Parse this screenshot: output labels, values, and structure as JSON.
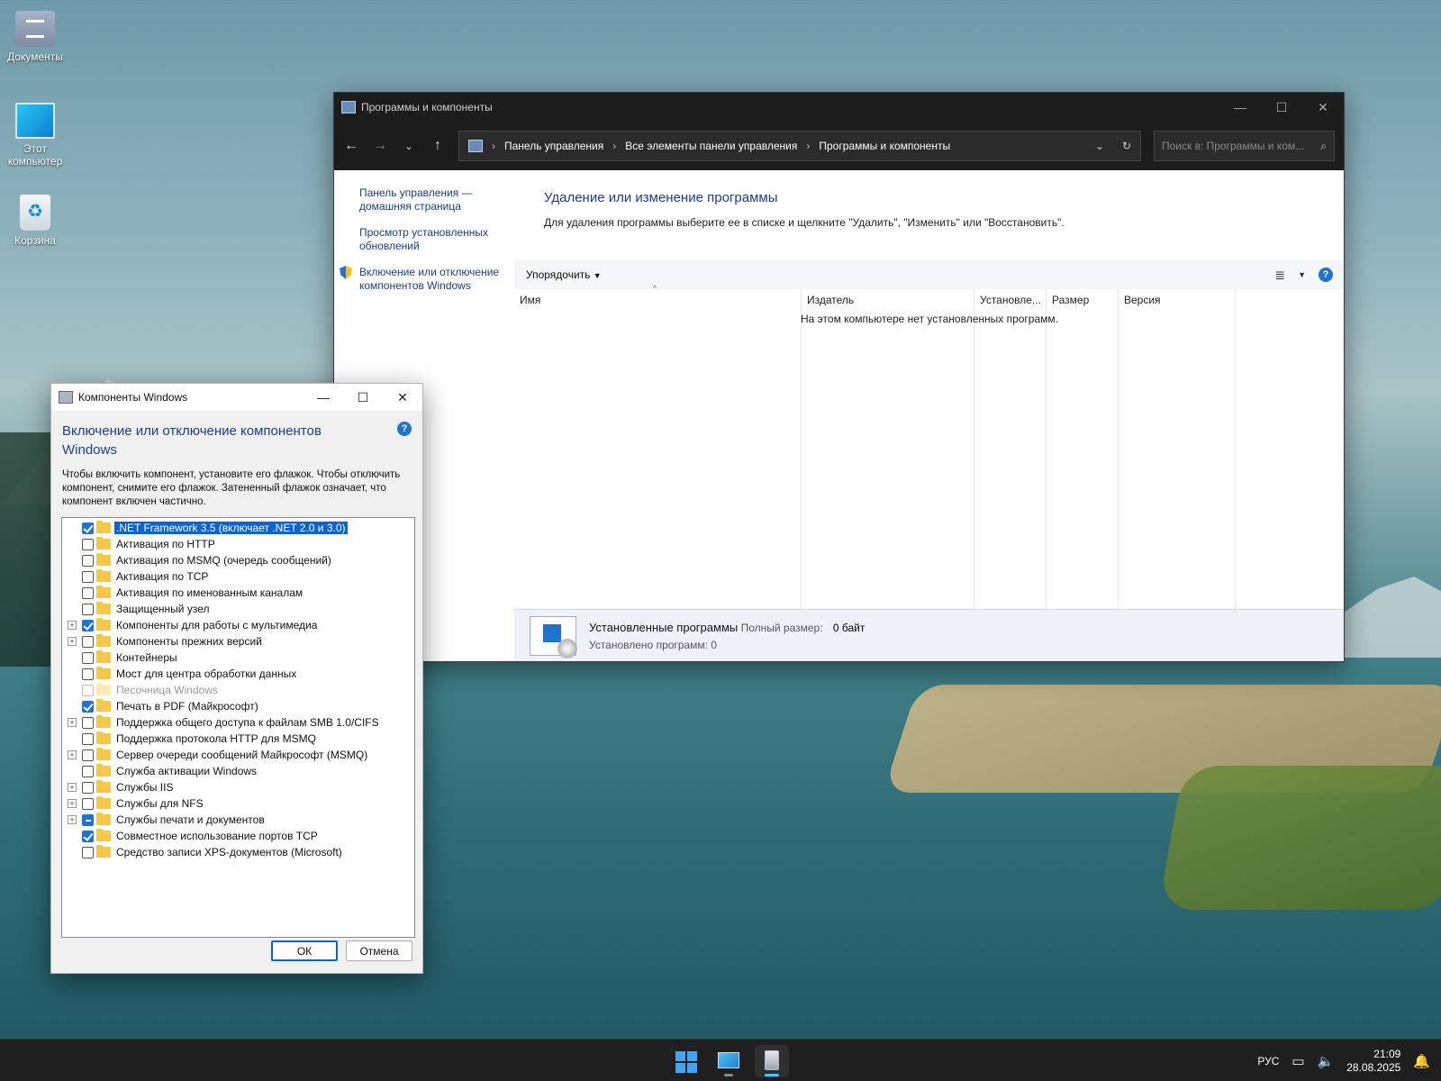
{
  "desktop": {
    "icons": [
      {
        "label": "Документы",
        "icon": "documents-folder-icon"
      },
      {
        "label": "Этот компьютер",
        "icon": "this-pc-icon"
      },
      {
        "label": "Корзина",
        "icon": "recycle-bin-icon"
      }
    ]
  },
  "programs_window": {
    "title": "Программы и компоненты",
    "breadcrumb": [
      "Панель управления",
      "Все элементы панели управления",
      "Программы и компоненты"
    ],
    "search_placeholder": "Поиск в: Программы и ком...",
    "sidebar_links": [
      "Панель управления — домашняя страница",
      "Просмотр установленных обновлений",
      "Включение или отключение компонентов Windows"
    ],
    "heading": "Удаление или изменение программы",
    "description": "Для удаления программы выберите ее в списке и щелкните \"Удалить\", \"Изменить\" или \"Восстановить\".",
    "organize_label": "Упорядочить",
    "columns": [
      "Имя",
      "Издатель",
      "Установле...",
      "Размер",
      "Версия"
    ],
    "empty_message": "На этом компьютере нет установленных программ.",
    "details": {
      "title": "Установленные программы",
      "size_label": "Полный размер:",
      "size_value": "0 байт",
      "count_text": "Установлено программ: 0"
    }
  },
  "features_dialog": {
    "title": "Компоненты Windows",
    "heading": "Включение или отключение компонентов Windows",
    "description": "Чтобы включить компонент, установите его флажок. Чтобы отключить компонент, снимите его флажок. Затененный флажок означает, что компонент включен частично.",
    "items": [
      {
        "label": ".NET Framework 3.5 (включает .NET 2.0 и 3.0)",
        "state": "checked",
        "expandable": false,
        "selected": true
      },
      {
        "label": "Активация по HTTP",
        "state": "unchecked",
        "expandable": false
      },
      {
        "label": "Активация по MSMQ (очередь сообщений)",
        "state": "unchecked",
        "expandable": false
      },
      {
        "label": "Активация по TCP",
        "state": "unchecked",
        "expandable": false
      },
      {
        "label": "Активация по именованным каналам",
        "state": "unchecked",
        "expandable": false
      },
      {
        "label": "Защищенный узел",
        "state": "unchecked",
        "expandable": false
      },
      {
        "label": "Компоненты для работы с мультимедиа",
        "state": "checked",
        "expandable": true
      },
      {
        "label": "Компоненты прежних версий",
        "state": "unchecked",
        "expandable": true
      },
      {
        "label": "Контейнеры",
        "state": "unchecked",
        "expandable": false
      },
      {
        "label": "Мост для центра обработки данных",
        "state": "unchecked",
        "expandable": false
      },
      {
        "label": "Песочница Windows",
        "state": "disabled",
        "expandable": false
      },
      {
        "label": "Печать в PDF (Майкрософт)",
        "state": "checked",
        "expandable": false
      },
      {
        "label": "Поддержка общего доступа к файлам SMB 1.0/CIFS",
        "state": "unchecked",
        "expandable": true
      },
      {
        "label": "Поддержка протокола HTTP для MSMQ",
        "state": "unchecked",
        "expandable": false
      },
      {
        "label": "Сервер очереди сообщений Майкрософт (MSMQ)",
        "state": "unchecked",
        "expandable": true
      },
      {
        "label": "Служба активации Windows",
        "state": "unchecked",
        "expandable": false
      },
      {
        "label": "Службы IIS",
        "state": "unchecked",
        "expandable": true
      },
      {
        "label": "Службы для NFS",
        "state": "unchecked",
        "expandable": true
      },
      {
        "label": "Службы печати и документов",
        "state": "partial",
        "expandable": true
      },
      {
        "label": "Совместное использование портов TCP",
        "state": "checked",
        "expandable": false
      },
      {
        "label": "Средство записи XPS-документов (Microsoft)",
        "state": "unchecked",
        "expandable": false
      }
    ],
    "ok_label": "ОК",
    "cancel_label": "Отмена"
  },
  "taskbar": {
    "language": "РУС",
    "time": "21:09",
    "date": "28.08.2025"
  },
  "colors": {
    "accent": "#1e73d1",
    "link": "#1a3d8f",
    "titlebar_dark": "#1c1c1c"
  }
}
